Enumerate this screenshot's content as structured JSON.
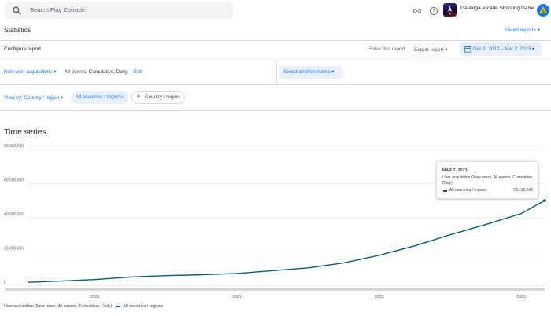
{
  "topbar": {
    "search_placeholder": "Search Play Console",
    "icons": [
      "link-icon",
      "help-icon"
    ],
    "app_name": "Galaxiga Arcade Shooting Game"
  },
  "header": {
    "title": "Statistics",
    "saved_reports": "Saved reports ▾"
  },
  "config": {
    "title": "Configure report",
    "save_report": "Save this report",
    "export_report": "Export report ▾",
    "date_range": "Dec 1, 2010 – Mar 2, 2023 ▾"
  },
  "metric": {
    "name": "New user acquisitions ▾",
    "description": "All events, Cumulative, Daily",
    "edit": "Edit",
    "select_another": "Select another metric ▾"
  },
  "viewby": {
    "label": "View by: Country / region ▾",
    "chip_all": "All countries / regions",
    "chip_add": "Country / region"
  },
  "section": {
    "title": "Time series"
  },
  "tooltip": {
    "date": "MAR 2, 2023",
    "metric": "User acquisition (New users, All events, Cumulative, Daily)",
    "country": "All countries / regions",
    "value": "50,112,346"
  },
  "legend": {
    "metric": "User acquisition (New users, All events, Cumulative, Daily)",
    "series": "All countries / regions"
  },
  "colors": {
    "accent": "#1a73e8",
    "series": "#0b5c7a"
  },
  "chart_data": {
    "type": "line",
    "yticks": [
      "80,000,000",
      "60,000,000",
      "40,000,000",
      "20,000,000",
      "0"
    ],
    "ytick_values": [
      80000000,
      60000000,
      40000000,
      20000000,
      0
    ],
    "xticks": [
      "2020",
      "2021",
      "2022",
      "2023"
    ],
    "xtick_positions": [
      "2020-01-01",
      "2021-01-01",
      "2022-01-01",
      "2023-01-01"
    ],
    "ylim": [
      0,
      80000000
    ],
    "xlim": [
      "2019-07-15",
      "2023-03-02"
    ],
    "series": [
      {
        "name": "All countries / regions",
        "x": [
          "2019-07-15",
          "2019-10-01",
          "2020-01-01",
          "2020-04-01",
          "2020-07-01",
          "2020-10-01",
          "2021-01-01",
          "2021-04-01",
          "2021-07-01",
          "2021-10-01",
          "2022-01-01",
          "2022-04-01",
          "2022-07-01",
          "2022-10-01",
          "2023-01-01",
          "2023-03-02"
        ],
        "y": [
          2200000,
          2900000,
          3800000,
          5300000,
          6100000,
          6600000,
          7400000,
          9000000,
          10600000,
          13500000,
          18000000,
          23500000,
          30000000,
          36000000,
          42500000,
          50112346
        ]
      }
    ],
    "grid": true,
    "legend_position": "bottom-left"
  }
}
